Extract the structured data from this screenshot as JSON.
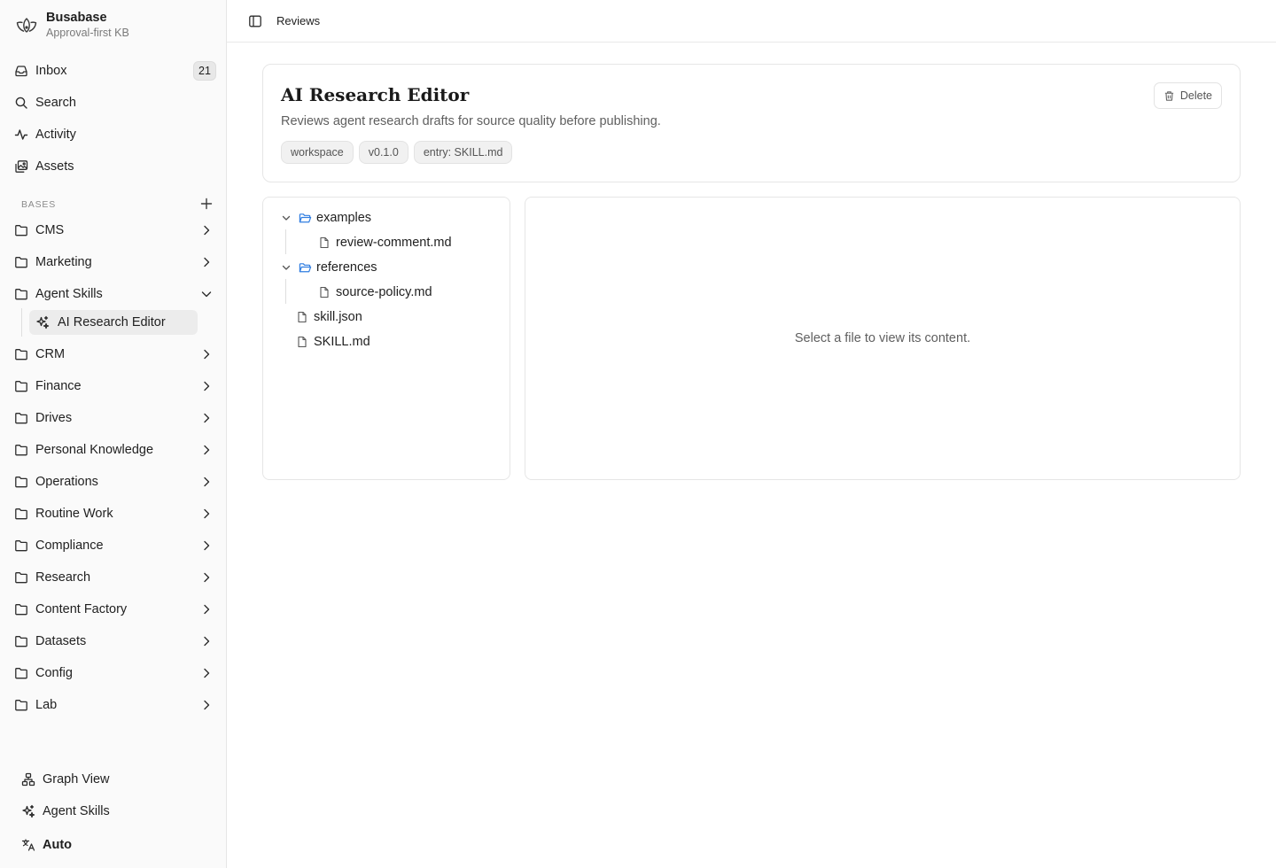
{
  "brand": {
    "name": "Busabase",
    "subtitle": "Approval-first KB"
  },
  "nav": {
    "inbox": {
      "label": "Inbox",
      "badge": "21"
    },
    "search": {
      "label": "Search"
    },
    "activity": {
      "label": "Activity"
    },
    "assets": {
      "label": "Assets"
    }
  },
  "bases": {
    "section_label": "BASES",
    "items": [
      {
        "label": "CMS"
      },
      {
        "label": "Marketing"
      },
      {
        "label": "Agent Skills",
        "expanded": true,
        "children": [
          {
            "label": "AI Research Editor",
            "selected": true
          }
        ]
      },
      {
        "label": "CRM"
      },
      {
        "label": "Finance"
      },
      {
        "label": "Drives"
      },
      {
        "label": "Personal Knowledge"
      },
      {
        "label": "Operations"
      },
      {
        "label": "Routine Work"
      },
      {
        "label": "Compliance"
      },
      {
        "label": "Research"
      },
      {
        "label": "Content Factory"
      },
      {
        "label": "Datasets"
      },
      {
        "label": "Config"
      },
      {
        "label": "Lab"
      }
    ]
  },
  "footer": {
    "graph_view": "Graph View",
    "agent_skills": "Agent Skills",
    "language": "Auto"
  },
  "topbar": {
    "breadcrumb": "Reviews"
  },
  "skill": {
    "title": "AI Research Editor",
    "description": "Reviews agent research drafts for source quality before publishing.",
    "tags": [
      "workspace",
      "v0.1.0",
      "entry: SKILL.md"
    ],
    "delete_label": "Delete"
  },
  "file_tree": {
    "folders": [
      {
        "name": "examples",
        "expanded": true,
        "files": [
          "review-comment.md"
        ]
      },
      {
        "name": "references",
        "expanded": true,
        "files": [
          "source-policy.md"
        ]
      }
    ],
    "files": [
      "skill.json",
      "SKILL.md"
    ]
  },
  "viewer": {
    "empty_message": "Select a file to view its content."
  },
  "colors": {
    "folder_icon": "#2f7de1",
    "selected_bg": "#ececec",
    "sidebar_bg": "#fafafa"
  }
}
